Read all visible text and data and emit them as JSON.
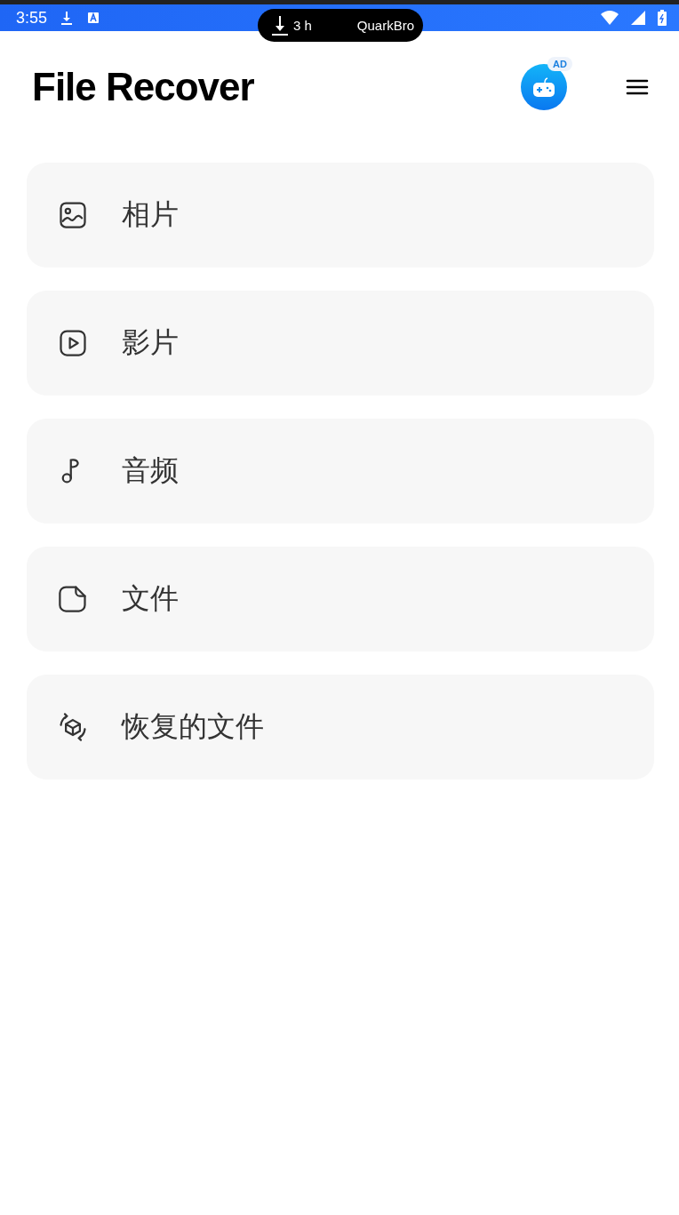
{
  "status_bar": {
    "time": "3:55"
  },
  "download_pill": {
    "duration": "3 h",
    "app": "QuarkBro"
  },
  "header": {
    "title": "File Recover",
    "ad_badge": "AD"
  },
  "categories": [
    {
      "kind": "photo",
      "label": "相片"
    },
    {
      "kind": "video",
      "label": "影片"
    },
    {
      "kind": "audio",
      "label": "音频"
    },
    {
      "kind": "document",
      "label": "文件"
    },
    {
      "kind": "recovered",
      "label": "恢复的文件"
    }
  ]
}
